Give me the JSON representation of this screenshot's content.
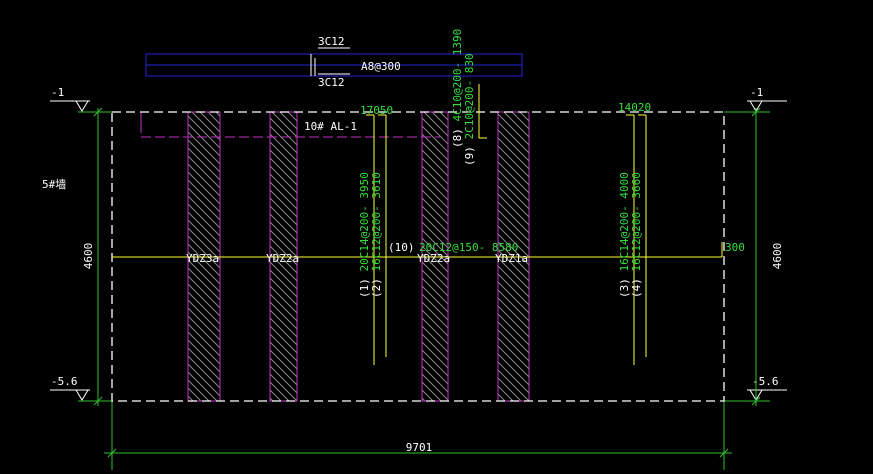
{
  "colors": {
    "background": "#000000",
    "frame": "#ffffff",
    "dimension": "#2fbf2f",
    "column_edge": "#c030c0",
    "hatch": "#8a8a8a",
    "rebar": "#ffff33",
    "beam_outline": "#2222dd",
    "text_white": "#ffffff",
    "text_green": "#33e03a"
  },
  "beam_section": {
    "top_label": "3C12",
    "bottom_label": "3C12",
    "stirrup_label": "A8@300"
  },
  "levels": {
    "top_left": "-1",
    "top_right": "-1",
    "bottom_left": "-5.6",
    "bottom_right": "-5.6"
  },
  "dimensions": {
    "height_left": "4600",
    "height_right": "4600",
    "width_bottom": "9701"
  },
  "wall_label": "5#墙",
  "beam_label": "10# AL-1",
  "columns": [
    "YDZ3a",
    "YDZ2a",
    "YDZ2a",
    "YDZ1a"
  ],
  "rebar_marks": {
    "mark_17050": "17050",
    "mark_14020": "14020",
    "mark_300": "300",
    "r1": "(1) 20C14@200- 3950",
    "r2": "(2) 16C12@200- 3610",
    "r3": "(3) 16C14@200- 4000",
    "r4": "(4) 16C12@200- 3660",
    "r8": "(8) 4C10@200- 1390",
    "r9": "(9) 2C10@200- 830",
    "r10_prefix": "(10)",
    "r10_text": "20C12@150- 8580"
  }
}
